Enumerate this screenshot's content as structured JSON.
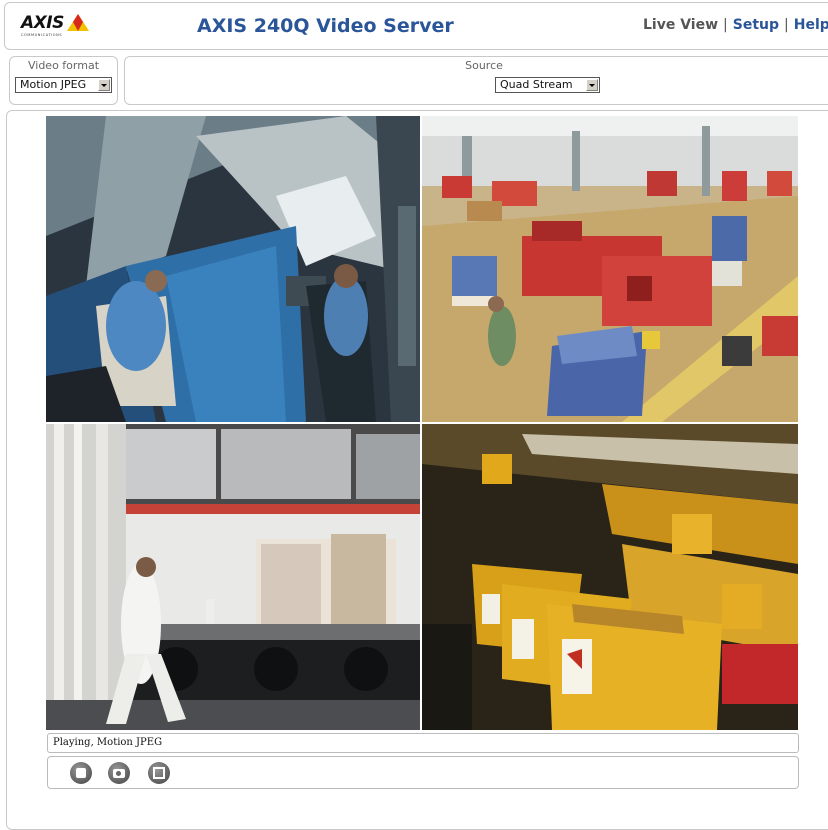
{
  "header": {
    "logo_text": "AXIS",
    "logo_subtext": "COMMUNICATIONS",
    "title": "AXIS 240Q Video Server",
    "nav": {
      "live_view": "Live View",
      "separator": "|",
      "setup": "Setup",
      "help": "Help"
    }
  },
  "video_format": {
    "label": "Video format",
    "selected": "Motion JPEG"
  },
  "source": {
    "label": "Source",
    "selected": "Quad Stream"
  },
  "video": {
    "quadrants": [
      "camera-1-printing-press",
      "camera-2-warehouse-floor",
      "camera-3-loading-dock",
      "camera-4-mail-carts"
    ]
  },
  "status": {
    "text": "Playing, Motion JPEG"
  },
  "controls": {
    "icons": [
      "stop-icon",
      "snapshot-icon",
      "fullscreen-icon"
    ]
  },
  "colors": {
    "title_blue": "#2a5599",
    "logo_yellow": "#f2c200",
    "logo_red": "#d72a1c"
  }
}
